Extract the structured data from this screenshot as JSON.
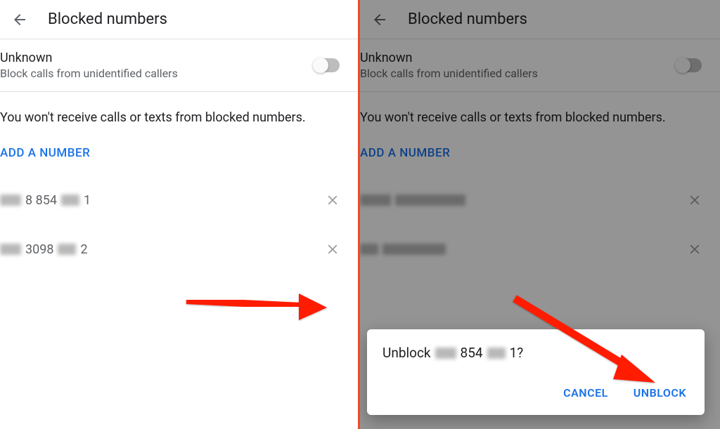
{
  "header": {
    "title": "Blocked numbers"
  },
  "unknown": {
    "title": "Unknown",
    "sub": "Block calls from unidentified callers"
  },
  "info_text": "You won't receive calls or texts from blocked numbers.",
  "add_label": "ADD A NUMBER",
  "numbers": {
    "n1_mid": "8 854",
    "n1_end": "1",
    "n2_mid": "3098",
    "n2_end": "2"
  },
  "dialog": {
    "prefix": "Unblock",
    "mid": "854",
    "end": "1?",
    "cancel": "CANCEL",
    "unblock": "UNBLOCK"
  }
}
